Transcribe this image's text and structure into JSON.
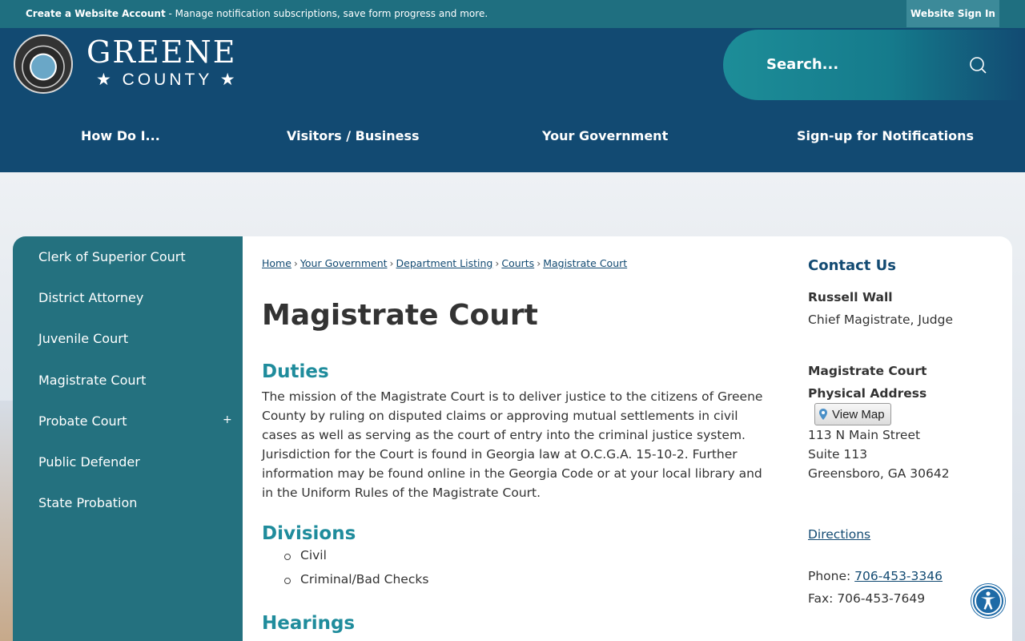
{
  "topbar": {
    "create_account": "Create a Website Account",
    "create_account_desc": " - Manage notification subscriptions, save form progress and more.",
    "sign_in": "Website Sign In"
  },
  "logo": {
    "line1": "GREENE",
    "line2": "★ COUNTY ★"
  },
  "search": {
    "placeholder": "Search..."
  },
  "nav": [
    "How Do I...",
    "Visitors / Business",
    "Your Government",
    "Sign-up for Notifications"
  ],
  "sidebar": {
    "items": [
      {
        "label": "Clerk of Superior Court"
      },
      {
        "label": "District Attorney"
      },
      {
        "label": "Juvenile Court"
      },
      {
        "label": "Magistrate Court"
      },
      {
        "label": "Probate Court",
        "expand": "+"
      },
      {
        "label": "Public Defender"
      },
      {
        "label": "State Probation"
      }
    ]
  },
  "breadcrumb": [
    "Home",
    "Your Government",
    "Department Listing",
    "Courts",
    "Magistrate Court"
  ],
  "page": {
    "title": "Magistrate Court",
    "duties_heading": "Duties",
    "duties_text": "The mission of the Magistrate Court is to deliver justice to the citizens of Greene County by ruling on disputed claims or approving mutual settlements in civil cases as well as serving as the court of entry into the criminal justice system. Jurisdiction for the Court is found in Georgia law at O.C.G.A. 15-10-2. Further information may be found online in the Georgia Code or at your local library and in the Uniform Rules of the Magistrate Court.",
    "divisions_heading": "Divisions",
    "divisions": [
      "Civil",
      "Criminal/Bad Checks"
    ],
    "hearings_heading": "Hearings"
  },
  "contact": {
    "title": "Contact Us",
    "name": "Russell Wall",
    "role": "Chief Magistrate, Judge",
    "org": "Magistrate Court",
    "address_label": "Physical Address",
    "view_map": "View Map",
    "street": "113 N Main Street",
    "suite": "Suite 113",
    "city": "Greensboro, GA 30642",
    "directions": "Directions",
    "phone_label": "Phone: ",
    "phone": "706-453-3346",
    "fax": "Fax: 706-453-7649"
  }
}
